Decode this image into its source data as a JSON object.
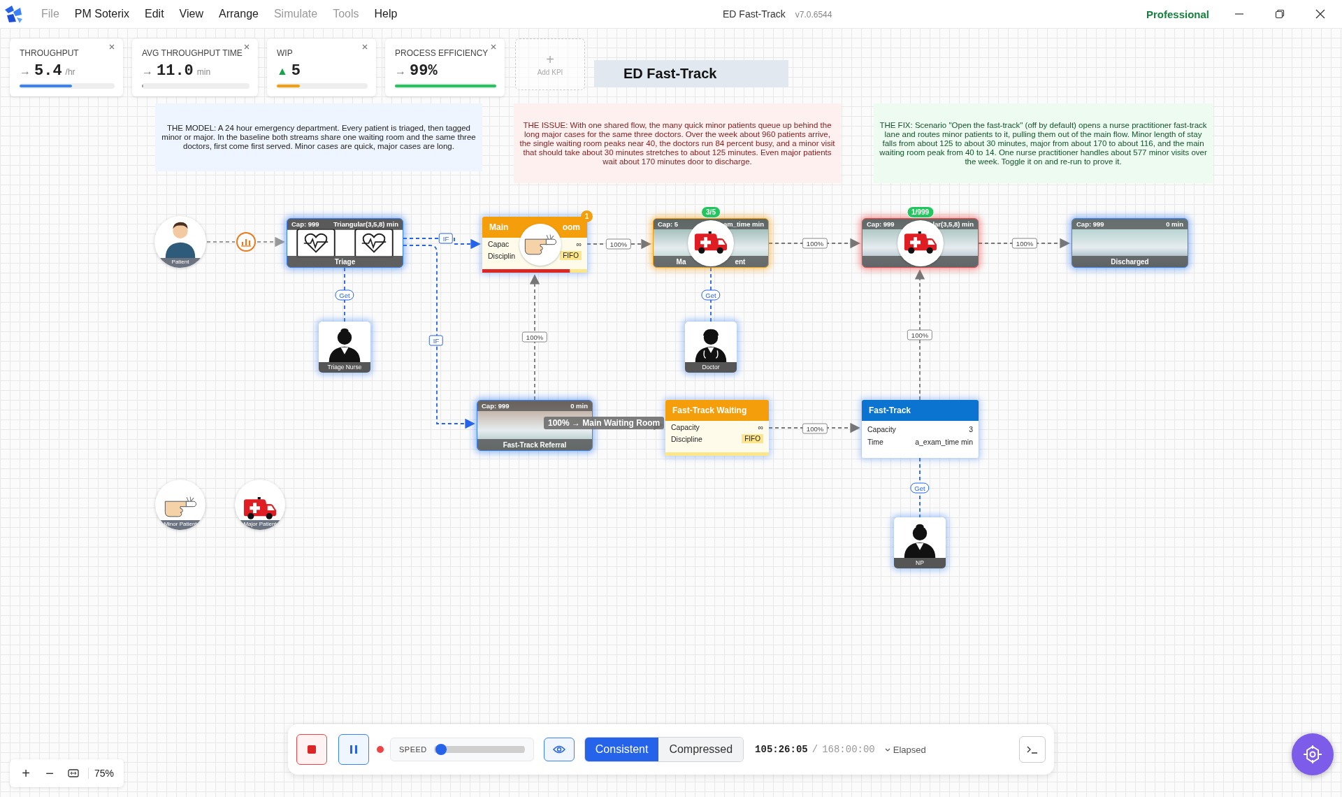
{
  "menu": {
    "items": [
      {
        "label": "File",
        "disabled": true
      },
      {
        "label": "PM Soterix",
        "disabled": false
      },
      {
        "label": "Edit",
        "disabled": false
      },
      {
        "label": "View",
        "disabled": false
      },
      {
        "label": "Arrange",
        "disabled": false
      },
      {
        "label": "Simulate",
        "disabled": true
      },
      {
        "label": "Tools",
        "disabled": true
      },
      {
        "label": "Help",
        "disabled": false
      }
    ],
    "title": "ED Fast-Track",
    "version": "v7.0.6544",
    "edition": "Professional"
  },
  "kpis": [
    {
      "title": "THROUGHPUT",
      "trend": "→",
      "trend_up": false,
      "value": "5.4",
      "unit": "/hr",
      "level": 0.55,
      "color": "#3b82f6"
    },
    {
      "title": "AVG THROUGHPUT TIME",
      "trend": "→",
      "trend_up": false,
      "value": "11.0",
      "unit": "min",
      "level": 0.01,
      "color": "#9ca3af"
    },
    {
      "title": "WIP",
      "trend": "▲",
      "trend_up": true,
      "value": "5",
      "level": 0.25,
      "color": "#f59e0b"
    },
    {
      "title": "PROCESS EFFICIENCY",
      "trend": "→",
      "trend_up": false,
      "value": "99%",
      "level": 1.0,
      "color": "#22c55e"
    }
  ],
  "add_kpi": {
    "icon": "+",
    "label": "Add KPI"
  },
  "canvas_title": "ED Fast-Track",
  "notes": [
    {
      "kind": "model",
      "text": "THE MODEL: A 24 hour emergency department. Every patient is triaged, then tagged minor or major. In the baseline both streams share one waiting room and the same three doctors, first come first served. Minor cases are quick, major cases are long."
    },
    {
      "kind": "issue",
      "text": "THE ISSUE: With one shared flow, the many quick minor patients queue up behind the long major cases for the same three doctors. Over the week about 960 patients arrive, the single waiting room peaks near 40, the doctors run 84 percent busy, and a minor visit that should take about 30 minutes stretches to about 125 minutes. Even major patients wait about 170 minutes door to discharge."
    },
    {
      "kind": "fix",
      "text": "THE FIX: Scenario \"Open the fast-track\" (off by default) opens a nurse practitioner fast-track lane and routes minor patients to it, pulling them out of the main flow. Minor length of stay falls from about 125 to about 30 minutes, major from about 170 to about 116, and the main waiting room peak from 40 to 14. One nurse practitioner handles about 577 minor visits over the week. Toggle it on and re-run to prove it."
    }
  ],
  "nodes": [
    {
      "kind": "source",
      "label": "Patient"
    },
    {
      "kind": "activity",
      "cap": "Cap: 999",
      "time": "Triangular(3,5,8) min",
      "label_parts": [
        "Triage"
      ],
      "color": "#3b82f6"
    },
    {
      "kind": "queue",
      "title_parts": [
        "Main",
        "oom"
      ],
      "rows": [
        {
          "label": "Capac",
          "value": "∞"
        },
        {
          "label": "Disciplin",
          "value": "FIFO"
        }
      ],
      "badge": "1",
      "level": 0.83,
      "color": "#f59e0b"
    },
    {
      "kind": "activity",
      "cap": "Cap: 5",
      "time": "am_time min",
      "label_parts": [
        "Ma",
        "ent"
      ],
      "badge": "3/5",
      "color": "#f59e0b"
    },
    {
      "kind": "activity",
      "cap": "Cap: 999",
      "time": "lar(3,5,8) min",
      "badge": "1/999",
      "color": "#ef4444"
    },
    {
      "kind": "activity",
      "cap": "Cap: 999",
      "time": "0 min",
      "label_parts": [
        "Discharged"
      ],
      "color": "#3b82f6"
    },
    {
      "kind": "resource",
      "label": "Triage Nurse"
    },
    {
      "kind": "resource",
      "label": "Doctor"
    },
    {
      "kind": "activity",
      "cap": "Cap: 999",
      "time": "0 min",
      "label_parts": [
        "Fast-Track Referral"
      ],
      "color": "#3b82f6"
    },
    {
      "kind": "queue",
      "title_parts": [
        "Fast-Track Waiting"
      ],
      "rows": [
        {
          "label": "Capacity",
          "value": "∞"
        },
        {
          "label": "Discipline",
          "value": "FIFO"
        }
      ],
      "color": "#f59e0b"
    },
    {
      "kind": "server",
      "title_parts": [
        "Fast-Track"
      ],
      "rows": [
        {
          "label": "Capacity",
          "value": "3"
        },
        {
          "label": "Time",
          "value": "a_exam_time min"
        }
      ],
      "color": "#0b74d1"
    },
    {
      "kind": "resource",
      "label": "NP"
    },
    {
      "kind": "source",
      "label": "Minor Patient"
    },
    {
      "kind": "source",
      "label": "Major Patient"
    }
  ],
  "edge_labels": [
    {
      "kind": "rule",
      "text": "IF"
    },
    {
      "kind": "resource",
      "text": "Get"
    },
    {
      "kind": "rule",
      "text": "IF"
    },
    {
      "kind": "flow",
      "text": "100%"
    },
    {
      "kind": "flow",
      "text": "100%"
    },
    {
      "kind": "resource",
      "text": "Get"
    },
    {
      "kind": "flow",
      "text": "100%"
    },
    {
      "kind": "flow",
      "text": "100%"
    },
    {
      "kind": "flow",
      "text": "100%"
    },
    {
      "kind": "flow",
      "text": "100%"
    },
    {
      "kind": "resource",
      "text": "Get"
    }
  ],
  "tooltip": "100% → Main Waiting Room",
  "controls": {
    "speed": {
      "label": "SPEED",
      "level": 0.02
    },
    "modes": [
      {
        "label": "Consistent",
        "selected": true
      },
      {
        "label": "Compressed",
        "selected": false
      }
    ],
    "elapsed": "105:26:05",
    "separator": "/",
    "total": "168:00:00",
    "clock_mode": "Elapsed"
  },
  "zoom": {
    "plus": "+",
    "minus": "−",
    "level": "75%"
  }
}
